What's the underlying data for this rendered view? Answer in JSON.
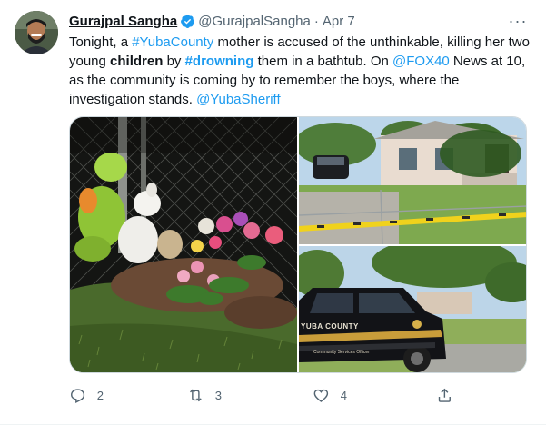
{
  "tweet": {
    "author_name": "Gurajpal Sangha",
    "author_handle": "@GurajpalSangha",
    "separator": "·",
    "date": "Apr 7",
    "more_glyph": "···",
    "text": {
      "t1": "Tonight, a ",
      "l1": "#YubaCounty",
      "t2": " mother is accused of the unthinkable, killing her two young ",
      "b1": "children",
      "t3": " by ",
      "l2": "#drowning",
      "t4": " them in a bathtub. On ",
      "l3": "@FOX40",
      "t5": " News at 10, as the community is coming by to remember the boys, where the investigation stands. ",
      "l4": "@YubaSheriff"
    },
    "media": {
      "left": {
        "depicts": "memorial-with-stuffed-animals-and-flowers"
      },
      "right_top": {
        "depicts": "house-with-yellow-police-tape"
      },
      "right_bottom": {
        "depicts": "sheriff-vehicle"
      },
      "vehicle_text": {
        "line1": "YUBA COUNTY",
        "line2": "Community Services Officer"
      }
    },
    "actions": {
      "reply_count": "2",
      "retweet_count": "3",
      "like_count": "4"
    },
    "colors": {
      "link": "#1d9bf0",
      "verified": "#1d9bf0",
      "muted": "#536471",
      "text": "#0f1419"
    }
  }
}
